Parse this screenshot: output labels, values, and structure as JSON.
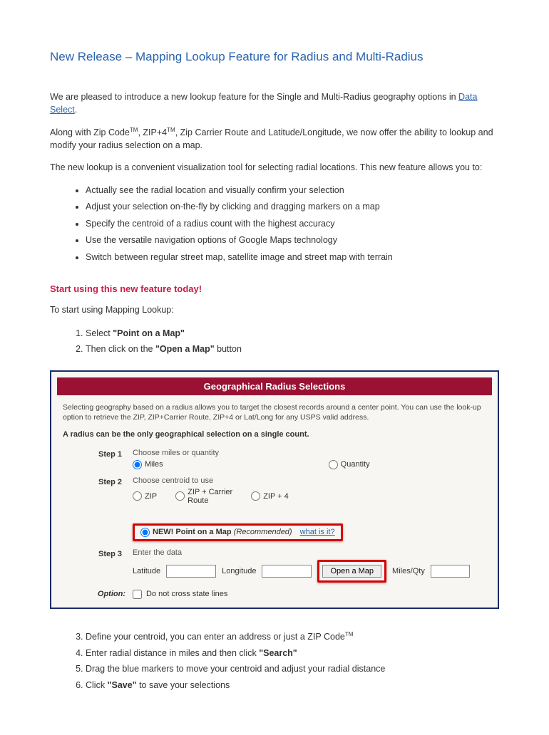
{
  "title": "New Release – Mapping Lookup Feature for Radius and Multi-Radius",
  "intro": {
    "p1a": "We are pleased to introduce a new lookup feature for the Single and Multi-Radius geography options in ",
    "link": "Data Select",
    "p1b": ".",
    "p2a": "Along with Zip Code",
    "tm": "TM",
    "p2b": ", ZIP+4",
    "p2c": ", Zip Carrier Route and Latitude/Longitude, we now offer the ability to lookup and modify your radius selection on a map.",
    "p3": "The new lookup is a convenient visualization tool for selecting radial locations. This new feature allows you to:"
  },
  "bullets": [
    "Actually see the radial location and visually confirm your selection",
    "Adjust your selection on-the-fly by clicking and dragging markers on a map",
    "Specify the centroid of a radius count with the highest accuracy",
    "Use the versatile navigation options of Google Maps technology",
    "Switch between regular street map, satellite image and street map with terrain"
  ],
  "promo": "Start using this new feature today!",
  "howto_intro": "To start using Mapping Lookup:",
  "steps_a": {
    "s1a": "Select ",
    "s1b": "\"Point on a Map\"",
    "s2a": "Then click on the ",
    "s2b": "\"Open a Map\"",
    "s2c": " button"
  },
  "panel": {
    "header": "Geographical Radius Selections",
    "desc": "Selecting geography based on a radius allows you to target the closest records around a center point. You can use the look-up option to retrieve the ZIP, ZIP+Carrier Route, ZIP+4 or Lat/Long for any USPS valid address.",
    "boldline": "A radius can be the only geographical selection on a single count.",
    "step1": {
      "label": "Step 1",
      "title": "Choose miles or quantity",
      "miles": "Miles",
      "qty": "Quantity"
    },
    "step2": {
      "label": "Step 2",
      "title": "Choose centroid to use",
      "zip": "ZIP",
      "zcr": "ZIP + Carrier Route",
      "zip4": "ZIP + 4",
      "new": "NEW! Point on a Map",
      "rec": "(Recommended)",
      "what": "what is it?"
    },
    "step3": {
      "label": "Step 3",
      "title": "Enter the data",
      "lat": "Latitude",
      "lon": "Longitude",
      "open": "Open a Map",
      "mq": "Miles/Qty"
    },
    "option": {
      "label": "Option:",
      "text": "Do not cross state lines"
    }
  },
  "steps_b": {
    "s3a": "Define your centroid, you can enter an address or just a ZIP Code",
    "s4a": "Enter radial distance in miles and then click ",
    "s4b": "\"Search\"",
    "s5": "Drag the blue markers to move your centroid and adjust your radial distance",
    "s6a": "Click ",
    "s6b": "\"Save\"",
    "s6c": "  to save your selections"
  }
}
